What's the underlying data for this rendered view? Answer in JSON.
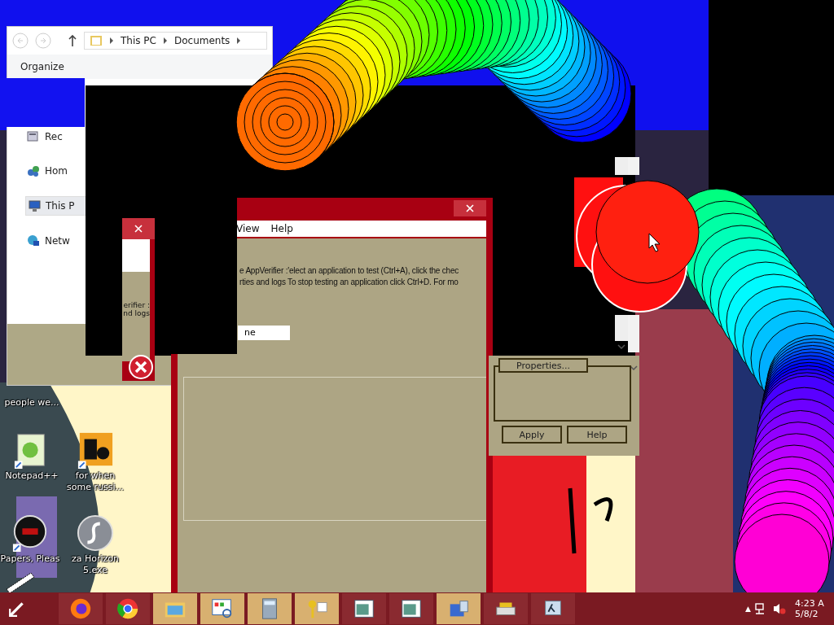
{
  "explorer": {
    "breadcrumb": [
      "This PC",
      "Documents"
    ],
    "toolbar": [
      "Organize"
    ],
    "sidebar": [
      {
        "label": "Rec",
        "kind": "recent",
        "selected": false
      },
      {
        "label": "Hom",
        "kind": "homegroup",
        "selected": false
      },
      {
        "label": "This P",
        "kind": "computer",
        "selected": true
      },
      {
        "label": "Netw",
        "kind": "network",
        "selected": false
      }
    ]
  },
  "small_dialog": {
    "lines": [
      "erifier :",
      "nd logs"
    ]
  },
  "appverifier": {
    "menu": [
      "View",
      "Help"
    ],
    "lines": [
      "e AppVerifier :'elect an application to test (Ctrl+A), click the chec",
      "rties and logs  To stop testing an application click Ctrl+D. For mo"
    ],
    "field": "ne"
  },
  "properties_dialog": {
    "buttons": [
      "Properties...",
      "Apply",
      "Help"
    ]
  },
  "desktop_icons": [
    {
      "label": "people we...",
      "kind": "none"
    },
    {
      "label": "Notepad++",
      "kind": "notepad"
    },
    {
      "label": "for when some russi...",
      "kind": "de"
    },
    {
      "label": "Papers, Pleas",
      "kind": "papers"
    },
    {
      "label": "za Horizon 5.exe",
      "kind": "flash"
    }
  ],
  "taskbar": {
    "apps": [
      {
        "kind": "firefox",
        "highlighted": false
      },
      {
        "kind": "chrome",
        "highlighted": false
      },
      {
        "kind": "folder",
        "highlighted": true
      },
      {
        "kind": "control",
        "highlighted": true
      },
      {
        "kind": "calculator",
        "highlighted": true
      },
      {
        "kind": "keys",
        "highlighted": true
      },
      {
        "kind": "window",
        "highlighted": false
      },
      {
        "kind": "window",
        "highlighted": false
      },
      {
        "kind": "network",
        "highlighted": true
      },
      {
        "kind": "printer",
        "highlighted": false
      },
      {
        "kind": "lambda",
        "highlighted": false
      }
    ],
    "tray_arrow": "▲",
    "time": "4:23 A",
    "date": "5/8/2"
  }
}
